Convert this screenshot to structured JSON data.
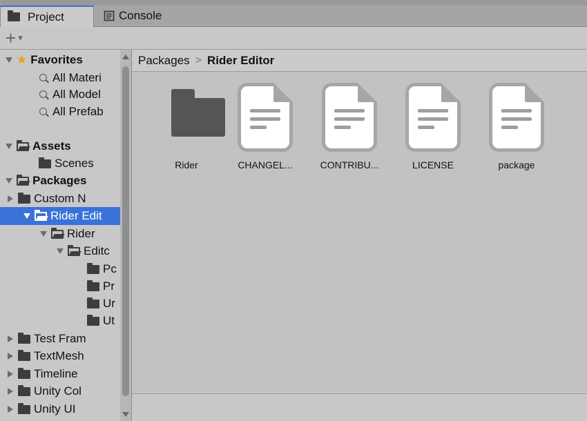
{
  "tabs": [
    {
      "label": "Project",
      "icon": "folder-icon",
      "active": true
    },
    {
      "label": "Console",
      "icon": "console-icon",
      "active": false
    }
  ],
  "toolbar": {
    "add_icon": "+",
    "dropdown_icon": "▾"
  },
  "tree": [
    {
      "label": "Favorites",
      "kind": "favorites"
    },
    {
      "label": "All Materi",
      "kind": "search"
    },
    {
      "label": "All Model",
      "kind": "search"
    },
    {
      "label": "All Prefab",
      "kind": "search"
    },
    {
      "label": "Assets",
      "kind": "root"
    },
    {
      "label": "Scenes",
      "kind": "folder"
    },
    {
      "label": "Packages",
      "kind": "root"
    },
    {
      "label": "Custom N",
      "kind": "folder"
    },
    {
      "label": "Rider Edit",
      "kind": "folder-open",
      "selected": true
    },
    {
      "label": "Rider",
      "kind": "folder-open"
    },
    {
      "label": "Editc",
      "kind": "folder-open"
    },
    {
      "label": "Pc",
      "kind": "folder"
    },
    {
      "label": "Pr",
      "kind": "folder"
    },
    {
      "label": "Ur",
      "kind": "folder"
    },
    {
      "label": "Ut",
      "kind": "folder"
    },
    {
      "label": "Test Fram",
      "kind": "folder"
    },
    {
      "label": "TextMesh",
      "kind": "folder"
    },
    {
      "label": "Timeline",
      "kind": "folder"
    },
    {
      "label": "Unity Col",
      "kind": "folder"
    },
    {
      "label": "Unity UI",
      "kind": "folder"
    }
  ],
  "breadcrumb": {
    "parent": "Packages",
    "separator": ">",
    "current": "Rider Editor"
  },
  "files": [
    {
      "label": "Rider",
      "type": "folder"
    },
    {
      "label": "CHANGEL...",
      "type": "document"
    },
    {
      "label": "CONTRIBU...",
      "type": "document"
    },
    {
      "label": "LICENSE",
      "type": "document"
    },
    {
      "label": "package",
      "type": "document"
    }
  ],
  "colors": {
    "selection": "#3a72d8",
    "favorite_star": "#e8a317",
    "background": "#c2c2c2"
  }
}
